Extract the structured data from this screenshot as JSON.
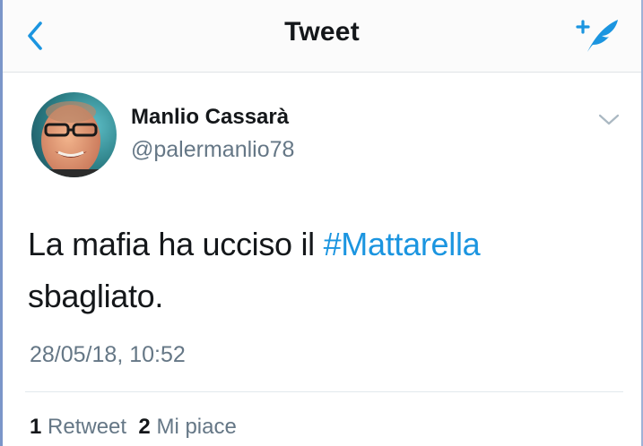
{
  "colors": {
    "accent": "#1b95e0",
    "text_primary": "#14171a",
    "text_secondary": "#657786",
    "divider": "#e1e8ed"
  },
  "navbar": {
    "back_icon": "chevron-left-icon",
    "title": "Tweet",
    "compose_icon": "compose-tweet-icon"
  },
  "tweet": {
    "author": {
      "display_name": "Manlio Cassarà",
      "handle": "@palermanlio78",
      "avatar_icon": "avatar-photo"
    },
    "menu_icon": "chevron-down-icon",
    "text_before": "La mafia ha ucciso il ",
    "hashtag": "#Mattarella",
    "text_after": "sbagliato.",
    "timestamp": "28/05/18, 10:52",
    "stats": {
      "retweets_count": "1",
      "retweets_label": "Retweet",
      "likes_count": "2",
      "likes_label": "Mi piace"
    }
  }
}
